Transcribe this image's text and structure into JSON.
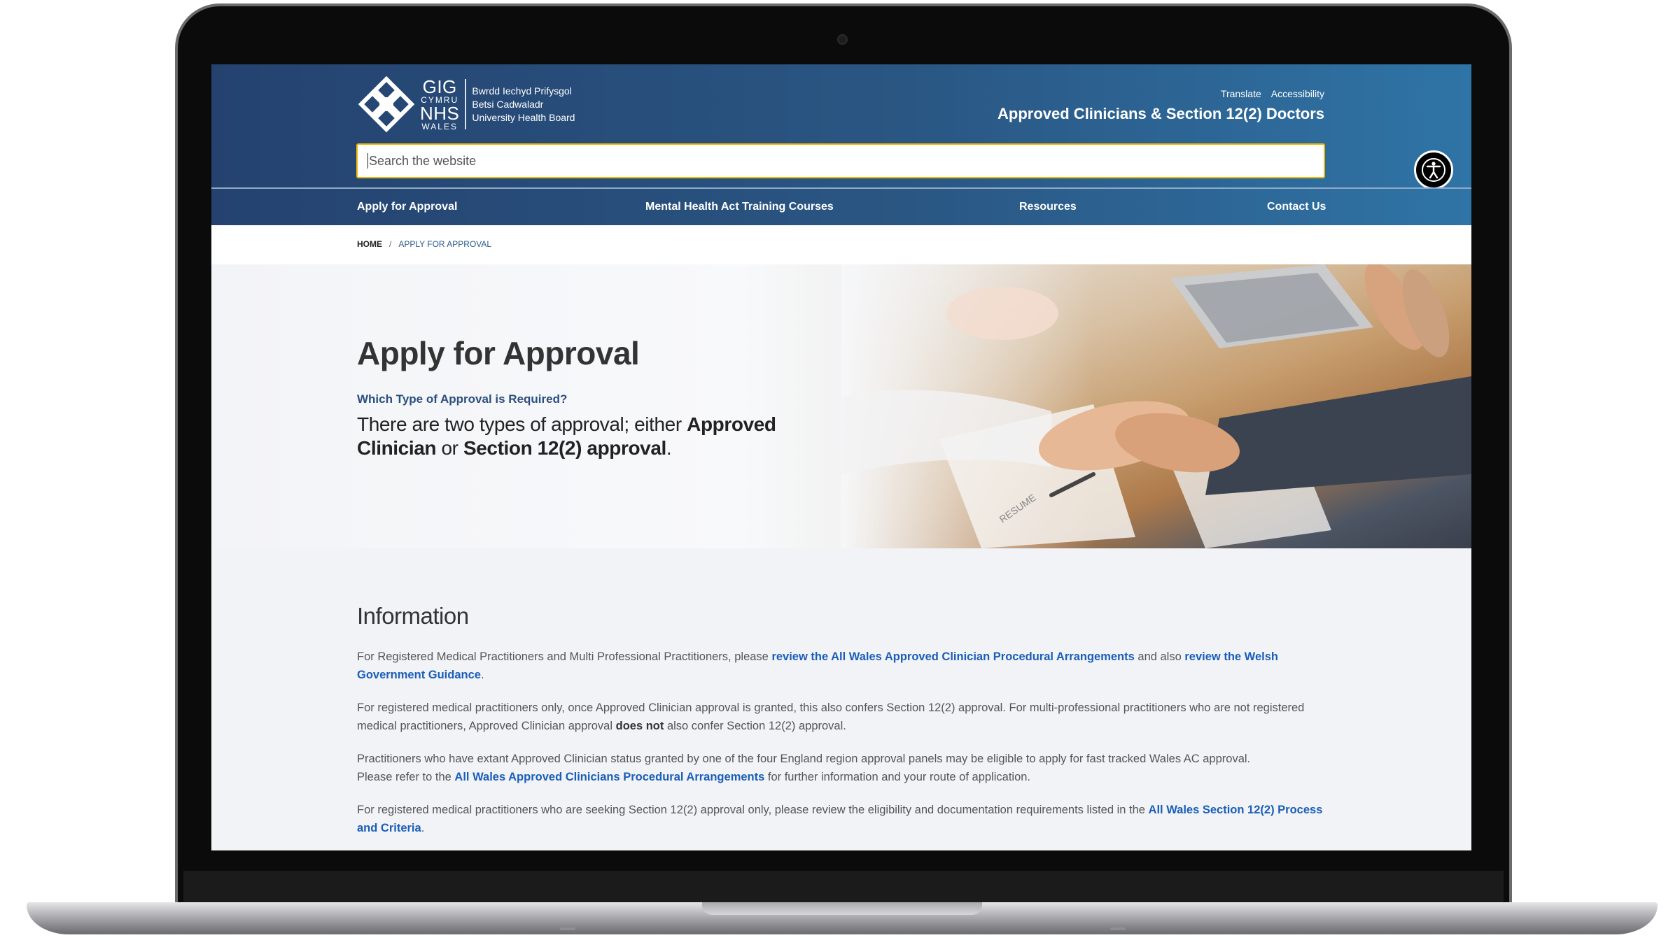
{
  "header": {
    "logo": {
      "gig": "GIG",
      "cymru": "CYMRU",
      "nhs": "NHS",
      "wales": "WALES",
      "board_lines": [
        "Bwrdd Iechyd Prifysgol",
        "Betsi Cadwaladr",
        "University Health Board"
      ]
    },
    "utility_links": [
      "Translate",
      "Accessibility"
    ],
    "site_title": "Approved Clinicians & Section 12(2) Doctors",
    "search": {
      "placeholder": "Search the website"
    },
    "accessibility_icon": "accessibility-person-icon"
  },
  "nav": {
    "items": [
      "Apply for Approval",
      "Mental Health Act Training Courses",
      "Resources",
      "Contact Us"
    ]
  },
  "breadcrumb": {
    "home": "HOME",
    "separator": "/",
    "current": "APPLY FOR APPROVAL"
  },
  "hero": {
    "title": "Apply for Approval",
    "subtitle": "Which Type of Approval is Required?",
    "lead_prefix": "There are two types of approval; either ",
    "lead_bold_1": "Approved Clinician",
    "lead_middle": " or ",
    "lead_bold_2": "Section 12(2) approval",
    "lead_suffix": ".",
    "image_paper_text": "RESUME"
  },
  "information": {
    "heading": "Information",
    "p1": {
      "text_1": "For Registered Medical Practitioners and Multi Professional Practitioners, please ",
      "link_1": "review the All Wales Approved Clinician Procedural Arrangements",
      "text_2": " and also ",
      "link_2": "review the Welsh Government Guidance",
      "text_3": "."
    },
    "p2": {
      "text_1": "For registered medical practitioners only, once Approved Clinician approval is granted, this also confers Section 12(2) approval.  For multi-professional practitioners who are not registered medical practitioners, Approved Clinician approval ",
      "bold": "does not",
      "text_2": " also confer Section 12(2) approval."
    },
    "p3": {
      "text_1": "Practitioners who have extant Approved Clinician status granted by one of the four England region approval panels may be eligible to apply for fast tracked Wales AC approval. Please refer to the ",
      "link": "All Wales Approved Clinicians Procedural Arrangements",
      "text_2": " for further information and your route of application."
    },
    "p4": {
      "text_1": "For registered medical practitioners who are seeking Section 12(2) approval only, please review the eligibility and documentation requirements listed in the ",
      "link": "All Wales Section 12(2) Process and Criteria",
      "text_2": "."
    }
  },
  "colors": {
    "header_start": "#25426f",
    "header_end": "#2f74a6",
    "link": "#1a5eb8",
    "search_border": "#f2b705",
    "subtitle": "#2b4f7e"
  }
}
